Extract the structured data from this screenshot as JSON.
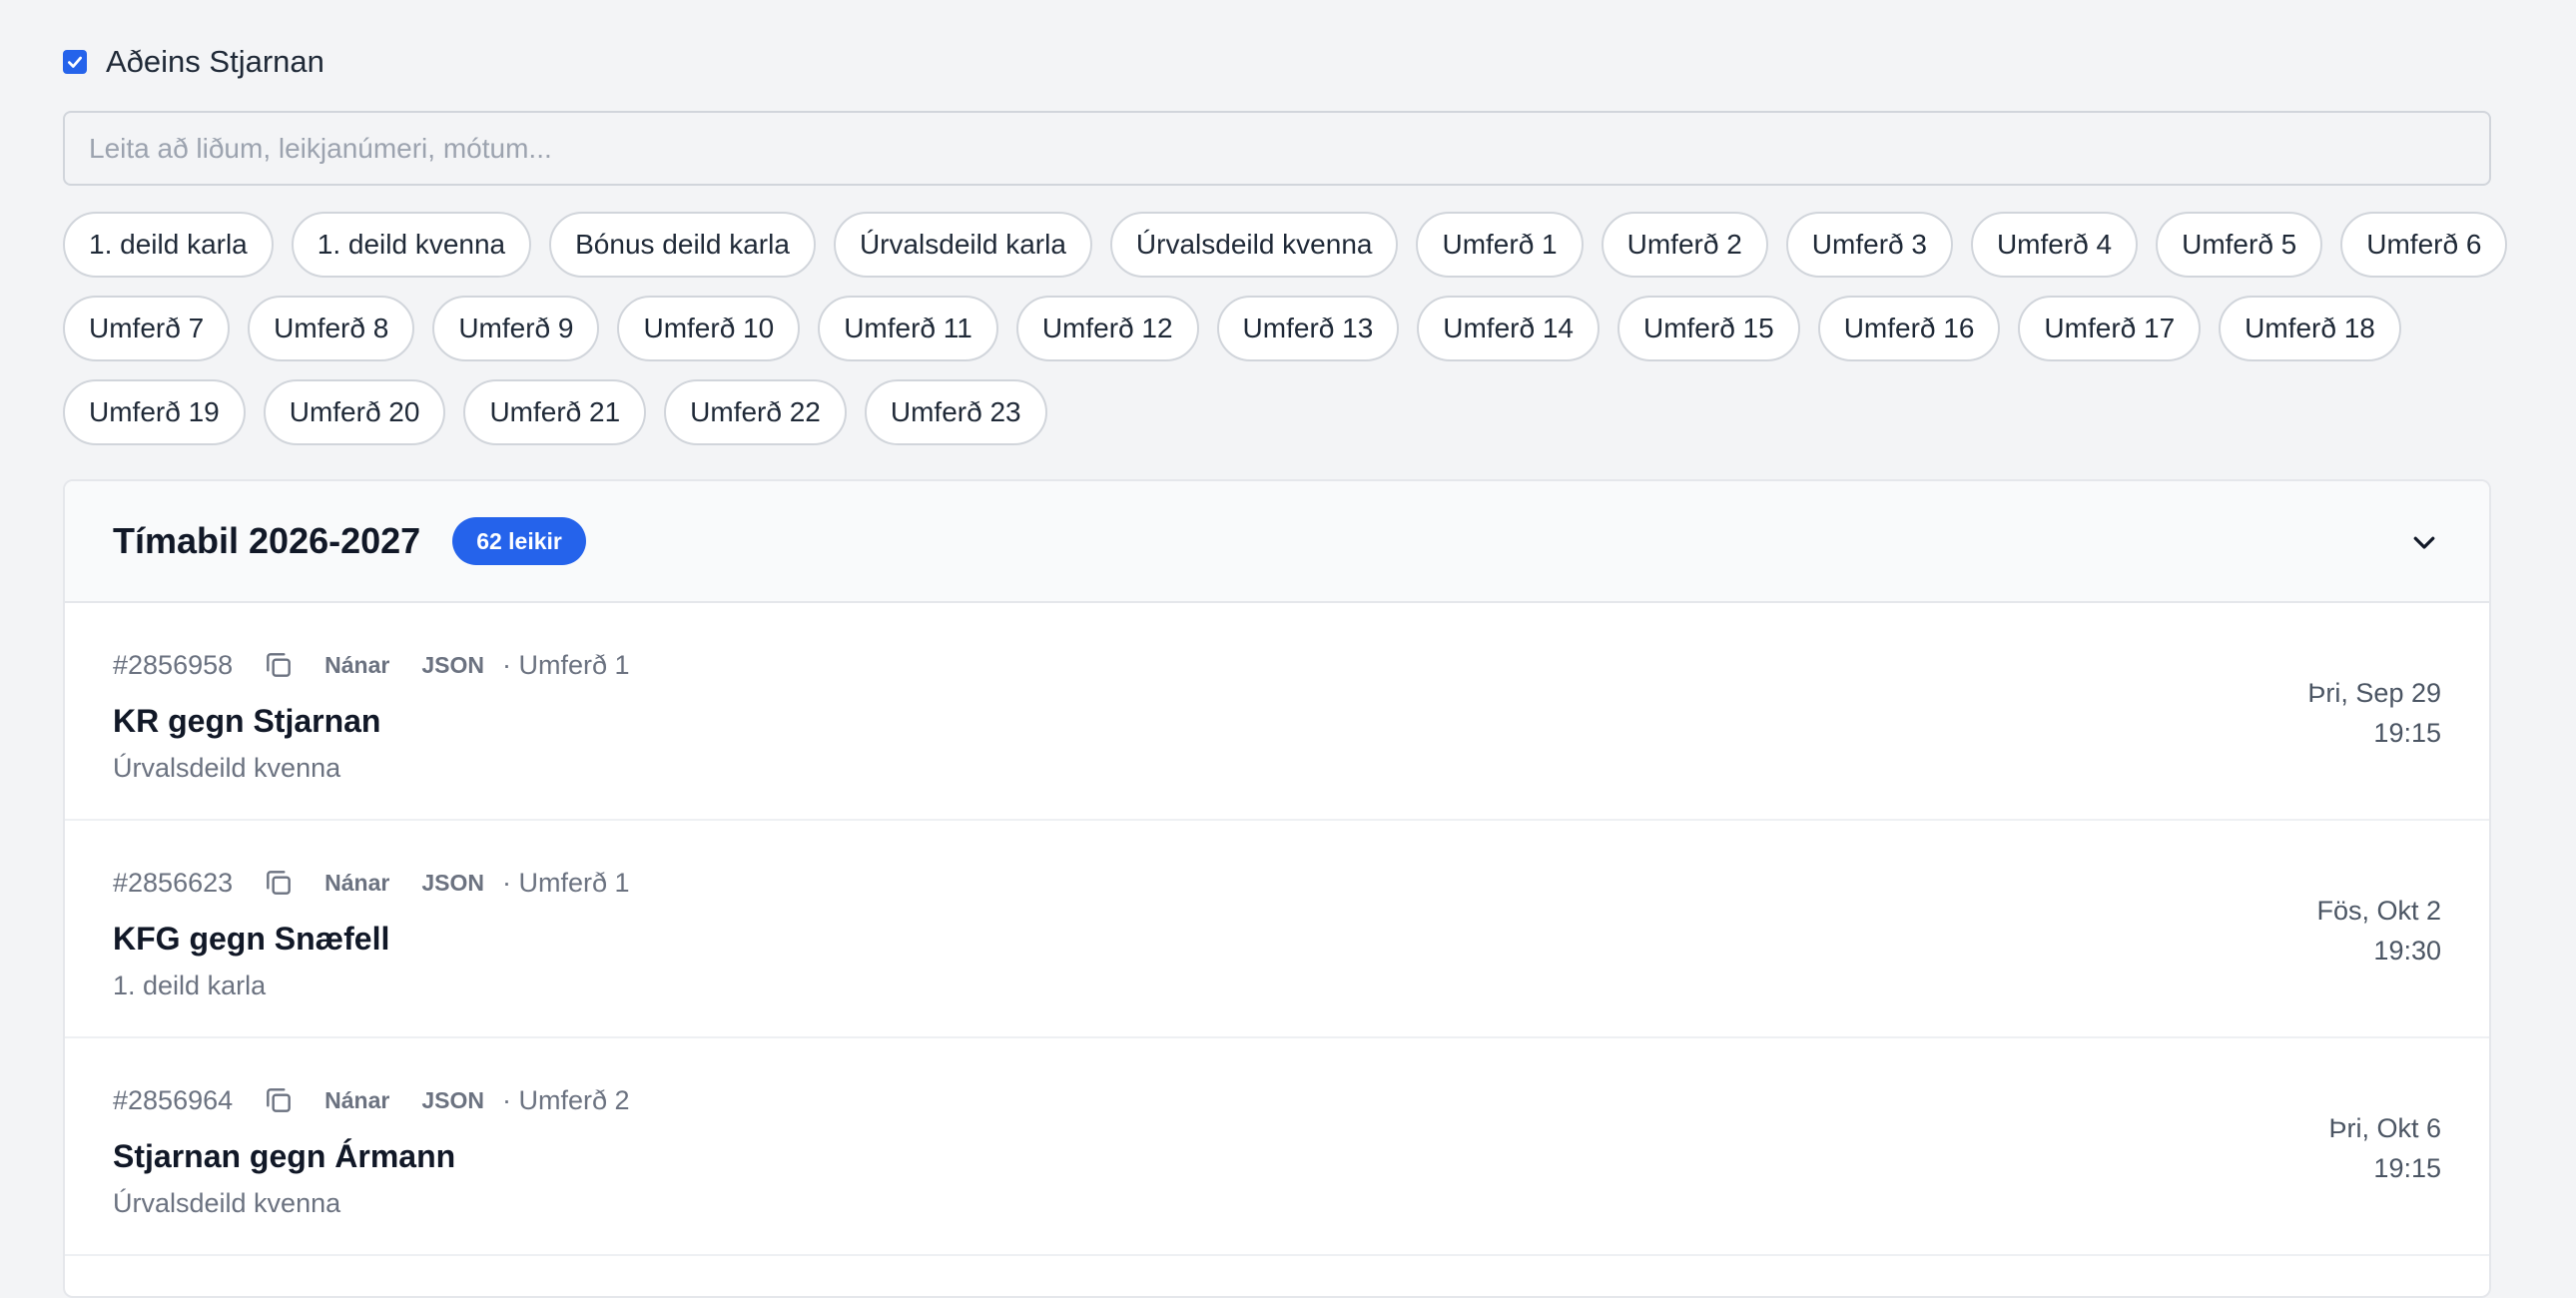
{
  "filter": {
    "label": "Aðeins Stjarnan",
    "checked": true
  },
  "search": {
    "placeholder": "Leita að liðum, leikjanúmeri, mótum...",
    "value": ""
  },
  "chips": {
    "row1": [
      "1. deild karla",
      "1. deild kvenna",
      "Bónus deild karla",
      "Úrvalsdeild karla",
      "Úrvalsdeild kvenna",
      "Umferð 1",
      "Umferð 2",
      "Umferð 3",
      "Umferð 4",
      "Umferð 5",
      "Umferð 6"
    ],
    "row2": [
      "Umferð 7",
      "Umferð 8",
      "Umferð 9",
      "Umferð 10",
      "Umferð 11",
      "Umferð 12",
      "Umferð 13",
      "Umferð 14",
      "Umferð 15",
      "Umferð 16",
      "Umferð 17",
      "Umferð 18"
    ],
    "row3": [
      "Umferð 19",
      "Umferð 20",
      "Umferð 21",
      "Umferð 22",
      "Umferð 23"
    ]
  },
  "season": {
    "title": "Tímabil 2026-2027",
    "badge": "62 leikir"
  },
  "games": [
    {
      "id": "#2856958",
      "details": "Nánar",
      "json": "JSON",
      "round": "· Umferð 1",
      "teams": "KR gegn Stjarnan",
      "league": "Úrvalsdeild kvenna",
      "date": "Þri, Sep 29",
      "time": "19:15"
    },
    {
      "id": "#2856623",
      "details": "Nánar",
      "json": "JSON",
      "round": "· Umferð 1",
      "teams": "KFG gegn Snæfell",
      "league": "1. deild karla",
      "date": "Fös, Okt 2",
      "time": "19:30"
    },
    {
      "id": "#2856964",
      "details": "Nánar",
      "json": "JSON",
      "round": "· Umferð 2",
      "teams": "Stjarnan gegn Ármann",
      "league": "Úrvalsdeild kvenna",
      "date": "Þri, Okt 6",
      "time": "19:15"
    }
  ],
  "colors": {
    "accent": "#2563eb",
    "background": "#f3f4f6"
  }
}
